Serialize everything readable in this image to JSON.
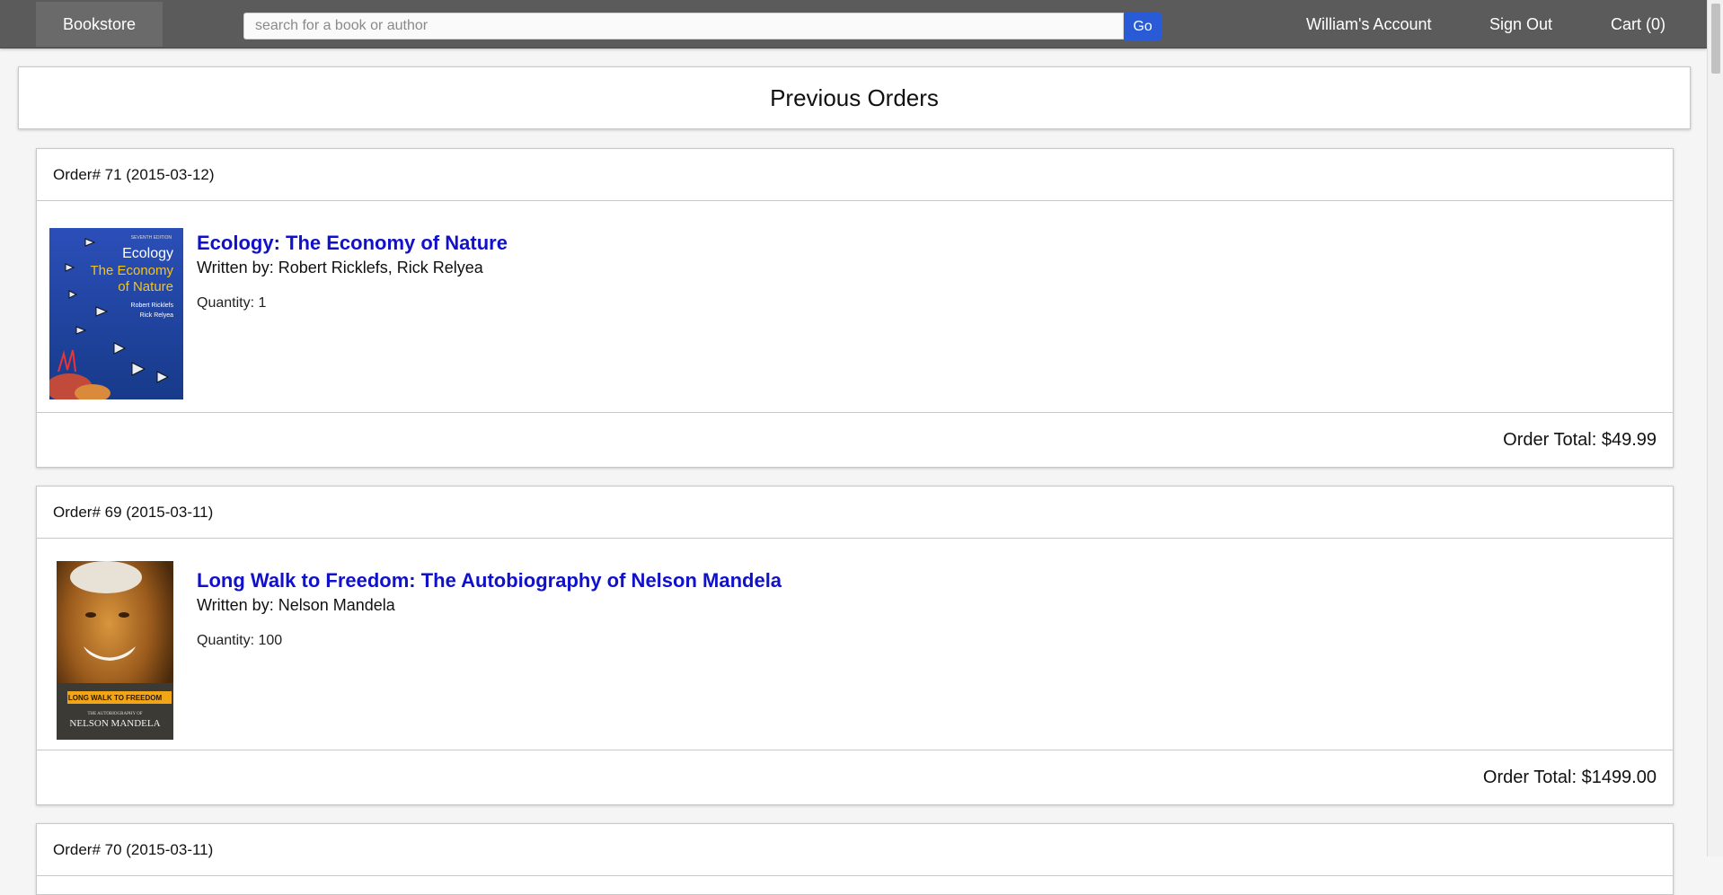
{
  "navbar": {
    "brand": "Bookstore",
    "search_placeholder": "search for a book or author",
    "search_value": "",
    "go_label": "Go",
    "account_label": "William's Account",
    "signout_label": "Sign Out",
    "cart_label": "Cart (0)"
  },
  "page": {
    "title": "Previous Orders"
  },
  "orders": [
    {
      "header": "Order# 71 (2015-03-12)",
      "item": {
        "title": "Ecology: The Economy of Nature",
        "author_line": "Written by: Robert Ricklefs, Rick Relyea",
        "quantity_line": "Quantity: 1",
        "cover": {
          "edition": "SEVENTH EDITION",
          "line1": "Ecology",
          "line2": "The Economy",
          "line3": "of Nature",
          "author1": "Robert Ricklefs",
          "author2": "Rick Relyea",
          "bg_color": "#1f3f9a",
          "accent_color": "#f0c420"
        }
      },
      "total": "Order Total: $49.99"
    },
    {
      "header": "Order# 69 (2015-03-11)",
      "item": {
        "title": "Long Walk to Freedom: The Autobiography of Nelson Mandela",
        "author_line": "Written by: Nelson Mandela",
        "quantity_line": "Quantity: 100",
        "cover": {
          "banner": "LONG WALK TO FREEDOM",
          "small_line": "THE AUTOBIOGRAPHY OF",
          "name": "NELSON MANDELA",
          "bg_color": "#7a4a18",
          "banner_color": "#f2a516"
        }
      },
      "total": "Order Total: $1499.00"
    },
    {
      "header": "Order# 70 (2015-03-11)"
    }
  ],
  "colors": {
    "navbar_bg": "#5b5b5b",
    "link": "#1111cc",
    "go_button": "#2a5bd7"
  }
}
